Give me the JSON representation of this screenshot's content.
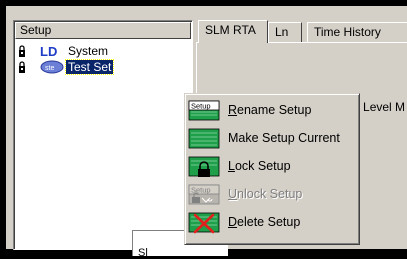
{
  "tree": {
    "header": "Setup",
    "items": [
      {
        "label": "System",
        "icon": "ld-system-icon",
        "selected": false
      },
      {
        "label": "Test Set",
        "icon": "ste-setup-icon",
        "selected": true
      }
    ]
  },
  "tabs": [
    {
      "label": "SLM RTA",
      "active": true
    },
    {
      "label": "Ln",
      "active": false
    },
    {
      "label": "Time History",
      "active": false
    }
  ],
  "content": {
    "sound_label": "Sound Level M",
    "box_text": "Sl"
  },
  "menu": {
    "items": [
      {
        "first": "R",
        "rest": "ename Setup",
        "icon": "setup-rename-icon",
        "enabled": true
      },
      {
        "first": "",
        "rest": "Make Setup Current",
        "icon": "setup-current-icon",
        "enabled": true
      },
      {
        "first": "L",
        "rest": "ock Setup",
        "icon": "setup-lock-icon",
        "enabled": true
      },
      {
        "first": "U",
        "rest": "nlock Setup",
        "icon": "setup-unlock-icon",
        "enabled": false
      },
      {
        "first": "D",
        "rest": "elete Setup",
        "icon": "setup-delete-icon",
        "enabled": true
      }
    ],
    "icon_text": "Setup"
  },
  "colors": {
    "face": "#d4d0c8",
    "selection": "#0a246a",
    "icon_green": "#1f9f4a",
    "delete_red": "#e0201c"
  }
}
